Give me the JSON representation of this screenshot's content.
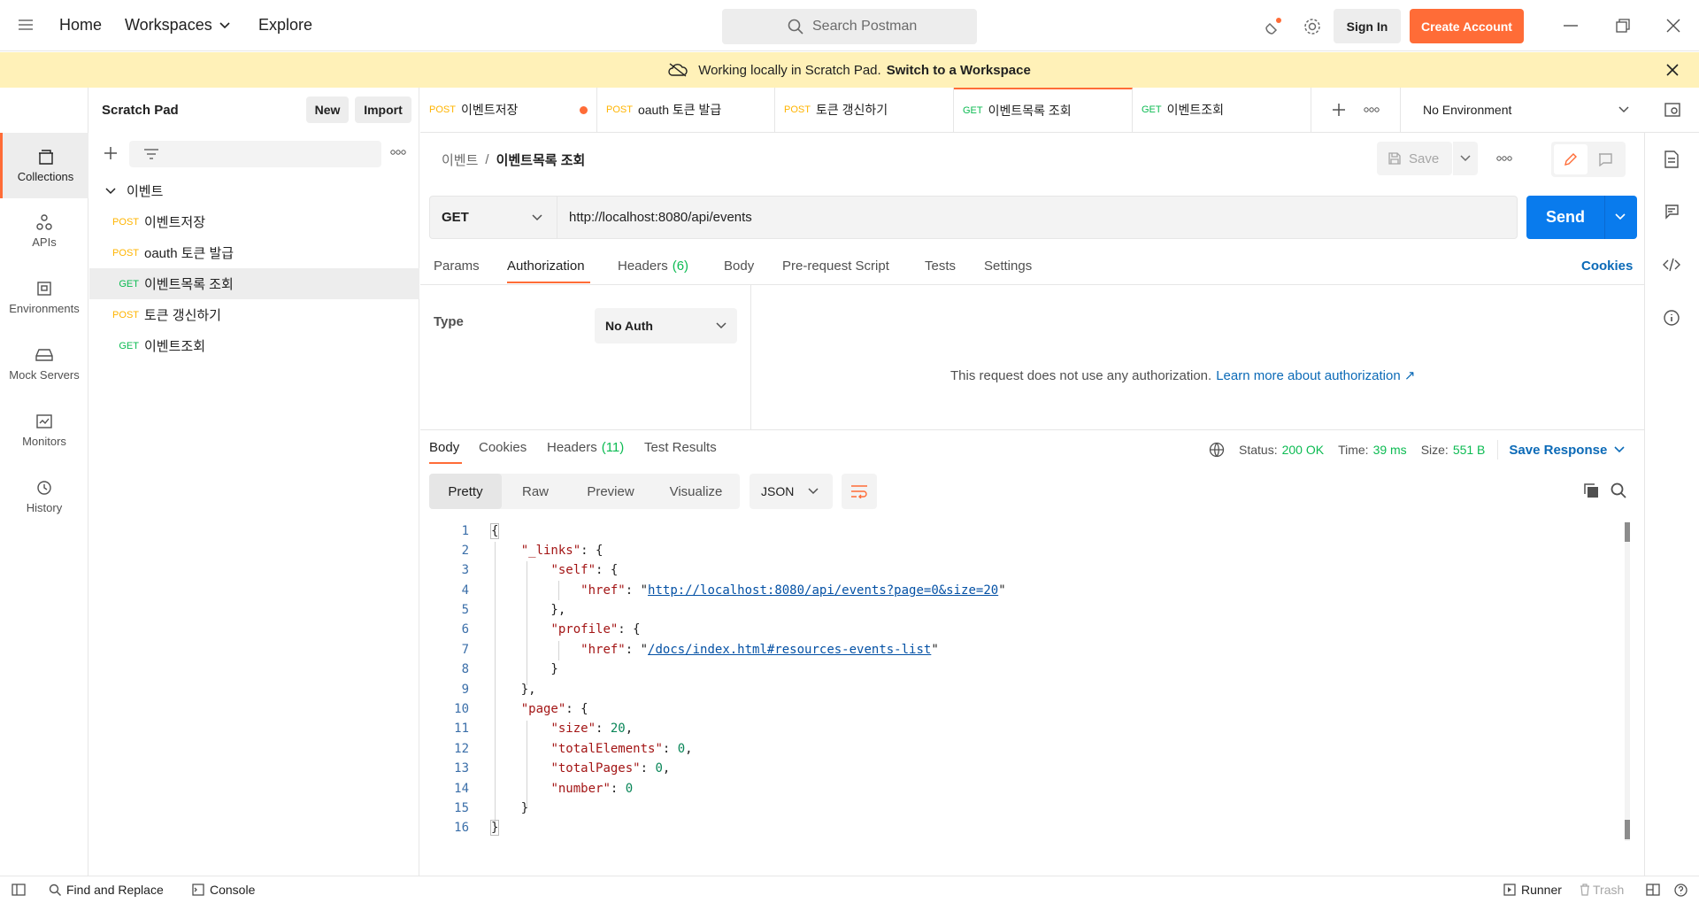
{
  "topbar": {
    "home": "Home",
    "workspaces": "Workspaces",
    "explore": "Explore",
    "search_placeholder": "Search Postman",
    "sign_in": "Sign In",
    "create_account": "Create Account"
  },
  "banner": {
    "text": "Working locally in Scratch Pad.",
    "link": "Switch to a Workspace"
  },
  "iconnav": {
    "items": [
      {
        "label": "Collections",
        "icon": "collections-icon"
      },
      {
        "label": "APIs",
        "icon": "apis-icon"
      },
      {
        "label": "Environments",
        "icon": "environments-icon"
      },
      {
        "label": "Mock Servers",
        "icon": "mock-servers-icon"
      },
      {
        "label": "Monitors",
        "icon": "monitors-icon"
      },
      {
        "label": "History",
        "icon": "history-icon"
      }
    ]
  },
  "sidebar": {
    "title": "Scratch Pad",
    "new": "New",
    "import": "Import",
    "folder": "이벤트",
    "items": [
      {
        "method": "POST",
        "name": "이벤트저장"
      },
      {
        "method": "POST",
        "name": "oauth 토큰 발급"
      },
      {
        "method": "GET",
        "name": "이벤트목록 조회"
      },
      {
        "method": "POST",
        "name": "토큰 갱신하기"
      },
      {
        "method": "GET",
        "name": "이벤트조회"
      }
    ]
  },
  "tabs": [
    {
      "method": "POST",
      "name": "이벤트저장"
    },
    {
      "method": "POST",
      "name": "oauth 토큰 발급"
    },
    {
      "method": "POST",
      "name": "토큰 갱신하기"
    },
    {
      "method": "GET",
      "name": "이벤트목록 조회"
    },
    {
      "method": "GET",
      "name": "이벤트조회"
    }
  ],
  "environment": "No Environment",
  "breadcrumb": {
    "parent": "이벤트",
    "sep": "/",
    "current": "이벤트목록 조회"
  },
  "save": "Save",
  "request": {
    "method": "GET",
    "url": "http://localhost:8080/api/events",
    "send": "Send"
  },
  "req_tabs": {
    "params": "Params",
    "authorization": "Authorization",
    "headers": "Headers",
    "headers_count": "(6)",
    "body": "Body",
    "prerequest": "Pre-request Script",
    "tests": "Tests",
    "settings": "Settings",
    "cookies": "Cookies"
  },
  "auth": {
    "type_label": "Type",
    "type_value": "No Auth",
    "message": "This request does not use any authorization.",
    "learn_more": "Learn more about authorization ↗"
  },
  "response": {
    "tabs": {
      "body": "Body",
      "cookies": "Cookies",
      "headers": "Headers",
      "headers_count": "(11)",
      "test_results": "Test Results"
    },
    "status_label": "Status:",
    "status_value": "200 OK",
    "time_label": "Time:",
    "time_value": "39 ms",
    "size_label": "Size:",
    "size_value": "551 B",
    "save_response": "Save Response",
    "view_modes": [
      "Pretty",
      "Raw",
      "Preview",
      "Visualize"
    ],
    "format": "JSON"
  },
  "code": {
    "line_numbers": [
      "1",
      "2",
      "3",
      "4",
      "5",
      "6",
      "7",
      "8",
      "9",
      "10",
      "11",
      "12",
      "13",
      "14",
      "15",
      "16"
    ],
    "self_href": "http://localhost:8080/api/events?page=0&size=20",
    "profile_href": "/docs/index.html#resources-events-list"
  },
  "statusbar": {
    "find_replace": "Find and Replace",
    "console": "Console",
    "runner": "Runner",
    "trash": "Trash"
  }
}
